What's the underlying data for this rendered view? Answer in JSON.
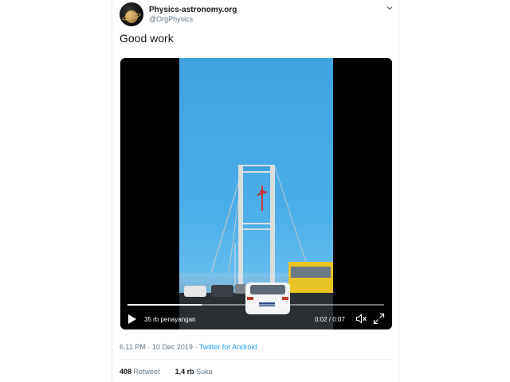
{
  "account": {
    "name": "Physics-astronomy.org",
    "handle": "@OrgPhysics"
  },
  "tweet": {
    "text": "Good work"
  },
  "video": {
    "views": "35 rb penayangan",
    "time": "0:02 / 0:07",
    "progress": 0.29
  },
  "meta": {
    "time": "6.11 PM",
    "separator": "·",
    "date": "10 Dec 2019",
    "source": "Twitter for Android"
  },
  "stats": {
    "retweets_count": "408",
    "retweets_label": "Retweet",
    "likes_count": "1,4 rb",
    "likes_label": "Suka"
  },
  "colors": {
    "link": "#1da1f2",
    "secondary_text": "#657786",
    "primary_text": "#14171a",
    "sky": "#4aaeea"
  },
  "icons": [
    "chevron-down-icon",
    "play-icon",
    "mute-icon",
    "fullscreen-icon"
  ]
}
